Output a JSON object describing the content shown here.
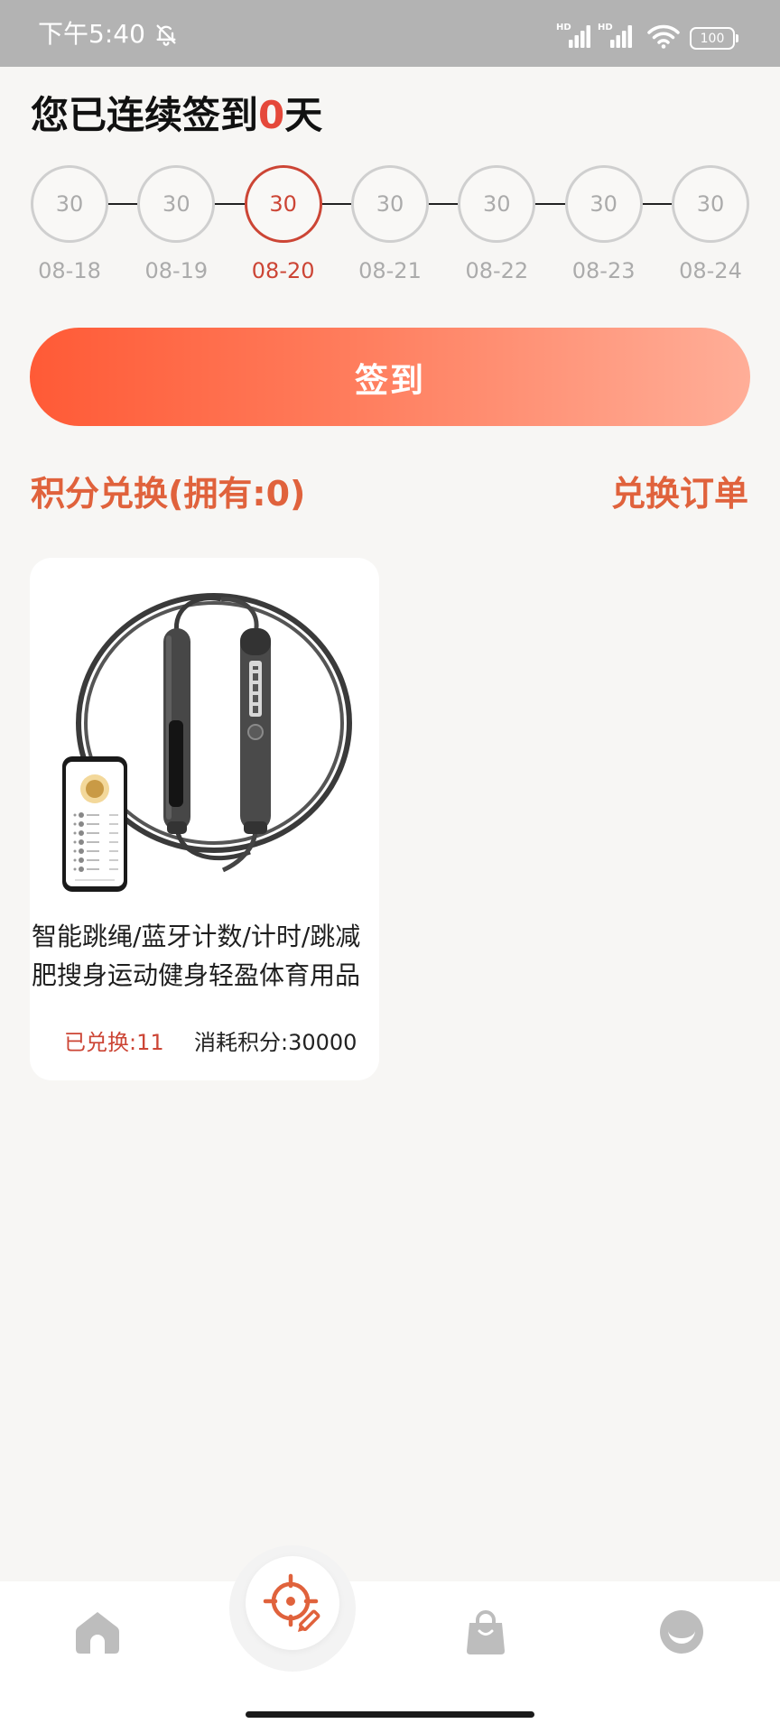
{
  "status_bar": {
    "time": "下午5:40",
    "signal_1_label": "HD",
    "signal_2_label": "HD",
    "battery_level": "100",
    "icons": [
      "bell-off-icon",
      "signal-icon",
      "signal-icon",
      "wifi-icon",
      "battery-icon"
    ]
  },
  "checkin": {
    "title_prefix": "您已连续签到",
    "streak_days": "0",
    "title_suffix": "天",
    "days": [
      {
        "points": "30",
        "date": "08-18",
        "today": false
      },
      {
        "points": "30",
        "date": "08-19",
        "today": false
      },
      {
        "points": "30",
        "date": "08-20",
        "today": true
      },
      {
        "points": "30",
        "date": "08-21",
        "today": false
      },
      {
        "points": "30",
        "date": "08-22",
        "today": false
      },
      {
        "points": "30",
        "date": "08-23",
        "today": false
      },
      {
        "points": "30",
        "date": "08-24",
        "today": false
      }
    ]
  },
  "sign_button": {
    "label": "签到"
  },
  "exchange": {
    "title": "积分兑换(拥有:0)",
    "orders_link": "兑换订单"
  },
  "products": [
    {
      "image_icon": "smart-jump-rope-image",
      "name": "智能跳绳/蓝牙计数/计时/跳减肥搜身运动健身轻盈体育用品",
      "redeemed": "已兑换:11",
      "cost": "消耗积分:30000"
    }
  ],
  "bottom_nav": {
    "items": [
      {
        "icon": "home-icon",
        "active": false
      },
      {
        "icon": "target-edit-icon",
        "active": true
      },
      {
        "icon": "shopping-bag-icon",
        "active": false
      },
      {
        "icon": "smile-icon",
        "active": false
      }
    ]
  },
  "colors": {
    "background": "#f7f6f4",
    "status_bar": "#b3b3b3",
    "accent": "#e0623c",
    "today": "#cc4535",
    "streak": "#e5483a",
    "muted": "#ababab",
    "sign_gradient_start": "#ff5a36",
    "sign_gradient_end": "#ffae98",
    "nav_icon": "#bdbdbd"
  }
}
